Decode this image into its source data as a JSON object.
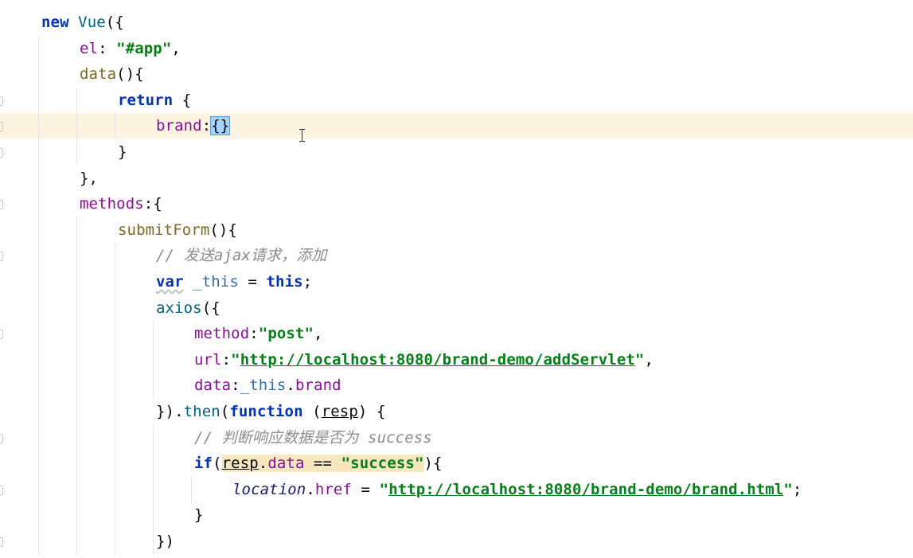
{
  "editor": {
    "lines": [
      {
        "indent": 0,
        "tokens": [
          {
            "t": "new ",
            "c": "kw"
          },
          {
            "t": "Vue",
            "c": "func"
          },
          {
            "t": "({",
            "c": ""
          }
        ]
      },
      {
        "indent": 1,
        "tokens": [
          {
            "t": "el",
            "c": "prop"
          },
          {
            "t": ": ",
            "c": ""
          },
          {
            "t": "\"#app\"",
            "c": "str"
          },
          {
            "t": ",",
            "c": ""
          }
        ]
      },
      {
        "indent": 1,
        "tokens": [
          {
            "t": "data",
            "c": "fnname"
          },
          {
            "t": "(){",
            "c": ""
          }
        ]
      },
      {
        "indent": 2,
        "tokens": [
          {
            "t": "return ",
            "c": "kw"
          },
          {
            "t": "{",
            "c": ""
          }
        ]
      },
      {
        "indent": 3,
        "current": true,
        "tokens": [
          {
            "t": "brand",
            "c": "prop"
          },
          {
            "t": ":",
            "c": ""
          },
          {
            "t": "{}",
            "c": "brace-sel"
          }
        ]
      },
      {
        "indent": 2,
        "tokens": [
          {
            "t": "}",
            "c": ""
          }
        ]
      },
      {
        "indent": 1,
        "tokens": [
          {
            "t": "},",
            "c": ""
          }
        ]
      },
      {
        "indent": 1,
        "tokens": [
          {
            "t": "methods",
            "c": "prop"
          },
          {
            "t": ":{",
            "c": ""
          }
        ]
      },
      {
        "indent": 2,
        "tokens": [
          {
            "t": "submitForm",
            "c": "fnname"
          },
          {
            "t": "(){",
            "c": ""
          }
        ]
      },
      {
        "indent": 3,
        "tokens": [
          {
            "t": "// 发送ajax请求，添加",
            "c": "cmt"
          }
        ]
      },
      {
        "indent": 3,
        "tokens": [
          {
            "t": "var",
            "c": "kw squiggle"
          },
          {
            "t": " ",
            "c": ""
          },
          {
            "t": "_this",
            "c": "local"
          },
          {
            "t": " = ",
            "c": ""
          },
          {
            "t": "this",
            "c": "kw"
          },
          {
            "t": ";",
            "c": ""
          }
        ]
      },
      {
        "indent": 3,
        "tokens": [
          {
            "t": "axios",
            "c": "func"
          },
          {
            "t": "({",
            "c": ""
          }
        ]
      },
      {
        "indent": 4,
        "tokens": [
          {
            "t": "method",
            "c": "prop"
          },
          {
            "t": ":",
            "c": ""
          },
          {
            "t": "\"post\"",
            "c": "str"
          },
          {
            "t": ",",
            "c": ""
          }
        ]
      },
      {
        "indent": 4,
        "tokens": [
          {
            "t": "url",
            "c": "prop"
          },
          {
            "t": ":",
            "c": ""
          },
          {
            "t": "\"",
            "c": "str"
          },
          {
            "t": "http://localhost:8080/brand-demo/addServlet",
            "c": "url"
          },
          {
            "t": "\"",
            "c": "str"
          },
          {
            "t": ",",
            "c": ""
          }
        ]
      },
      {
        "indent": 4,
        "tokens": [
          {
            "t": "data",
            "c": "prop"
          },
          {
            "t": ":",
            "c": ""
          },
          {
            "t": "_this",
            "c": "local"
          },
          {
            "t": ".",
            "c": ""
          },
          {
            "t": "brand",
            "c": "prop"
          }
        ]
      },
      {
        "indent": 3,
        "tokens": [
          {
            "t": "}).",
            "c": ""
          },
          {
            "t": "then",
            "c": "func"
          },
          {
            "t": "(",
            "c": ""
          },
          {
            "t": "function",
            "c": "kw"
          },
          {
            "t": " (",
            "c": ""
          },
          {
            "t": "resp",
            "c": "param"
          },
          {
            "t": ") {",
            "c": ""
          }
        ]
      },
      {
        "indent": 4,
        "tokens": [
          {
            "t": "// 判断响应数据是否为 success",
            "c": "cmt"
          }
        ]
      },
      {
        "indent": 4,
        "tokens": [
          {
            "t": "if",
            "c": "kw"
          },
          {
            "t": "(",
            "c": ""
          },
          {
            "t": "resp",
            "c": "param hl"
          },
          {
            "t": ".",
            "c": "hl"
          },
          {
            "t": "data",
            "c": "prop hl"
          },
          {
            "t": " == ",
            "c": "hl"
          },
          {
            "t": "\"success\"",
            "c": "str hl"
          },
          {
            "t": "){",
            "c": ""
          }
        ]
      },
      {
        "indent": 5,
        "tokens": [
          {
            "t": "location",
            "c": "italic-var"
          },
          {
            "t": ".",
            "c": ""
          },
          {
            "t": "href",
            "c": "prop"
          },
          {
            "t": " = ",
            "c": ""
          },
          {
            "t": "\"",
            "c": "str"
          },
          {
            "t": "http://localhost:8080/brand-demo/brand.html",
            "c": "url"
          },
          {
            "t": "\"",
            "c": "str"
          },
          {
            "t": ";",
            "c": ""
          }
        ]
      },
      {
        "indent": 4,
        "tokens": [
          {
            "t": "}",
            "c": ""
          }
        ]
      },
      {
        "indent": 3,
        "tokens": [
          {
            "t": "})",
            "c": ""
          }
        ]
      }
    ]
  }
}
